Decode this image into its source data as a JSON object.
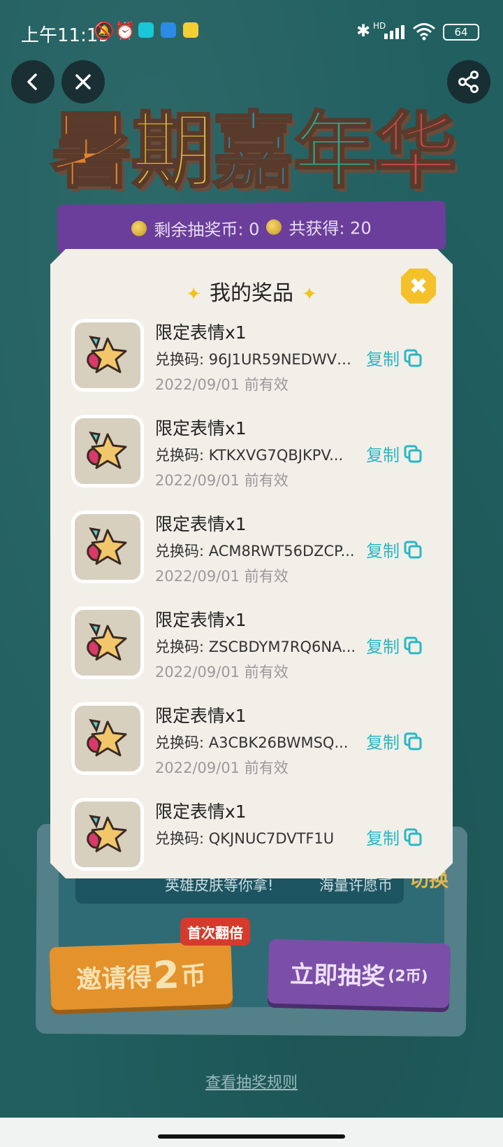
{
  "status_bar": {
    "time": "上午11:19",
    "battery": "64",
    "network_label": "HD"
  },
  "nav": {
    "back_icon": "chevron-left-icon",
    "close_icon": "close-icon",
    "share_icon": "share-icon"
  },
  "banner": {
    "title_chars": [
      "暑",
      "期",
      "嘉",
      "年",
      "华"
    ],
    "title_colors": [
      "#e0822f",
      "#e9c43c",
      "#2c8fb0",
      "#2aa58e",
      "#c9484a"
    ],
    "remaining_label": "剩余抽奖币: 0",
    "total_label": "共获得: 20"
  },
  "modal": {
    "title": "我的奖品",
    "close_icon": "close-icon",
    "copy_label": "复制",
    "prizes": [
      {
        "name": "限定表情x1",
        "code": "兑换码: 96J1UR59NEDWV1...",
        "expiry": "2022/09/01 前有效"
      },
      {
        "name": "限定表情x1",
        "code": "兑换码: KTKXVG7QBJKPV...",
        "expiry": "2022/09/01 前有效"
      },
      {
        "name": "限定表情x1",
        "code": "兑换码: ACM8RWT56DZCP...",
        "expiry": "2022/09/01 前有效"
      },
      {
        "name": "限定表情x1",
        "code": "兑换码: ZSCBDYM7RQ6NA...",
        "expiry": "2022/09/01 前有效"
      },
      {
        "name": "限定表情x1",
        "code": "兑换码: A3CBK26BWMSQ...",
        "expiry": "2022/09/01 前有效"
      },
      {
        "name": "限定表情x1",
        "code": "兑换码: QKJNUC7DVTF1U",
        "expiry": ""
      }
    ]
  },
  "background": {
    "wish_left": "英雄皮肤等你拿!",
    "wish_right": "海量许愿币",
    "switch_label": "切换",
    "invite_prefix": "邀请得",
    "invite_number": "2",
    "invite_suffix": "币",
    "double_tag": "首次翻倍",
    "draw_label": "立即抽奖",
    "draw_cost": "(2币)",
    "rules_link": "查看抽奖规则"
  }
}
